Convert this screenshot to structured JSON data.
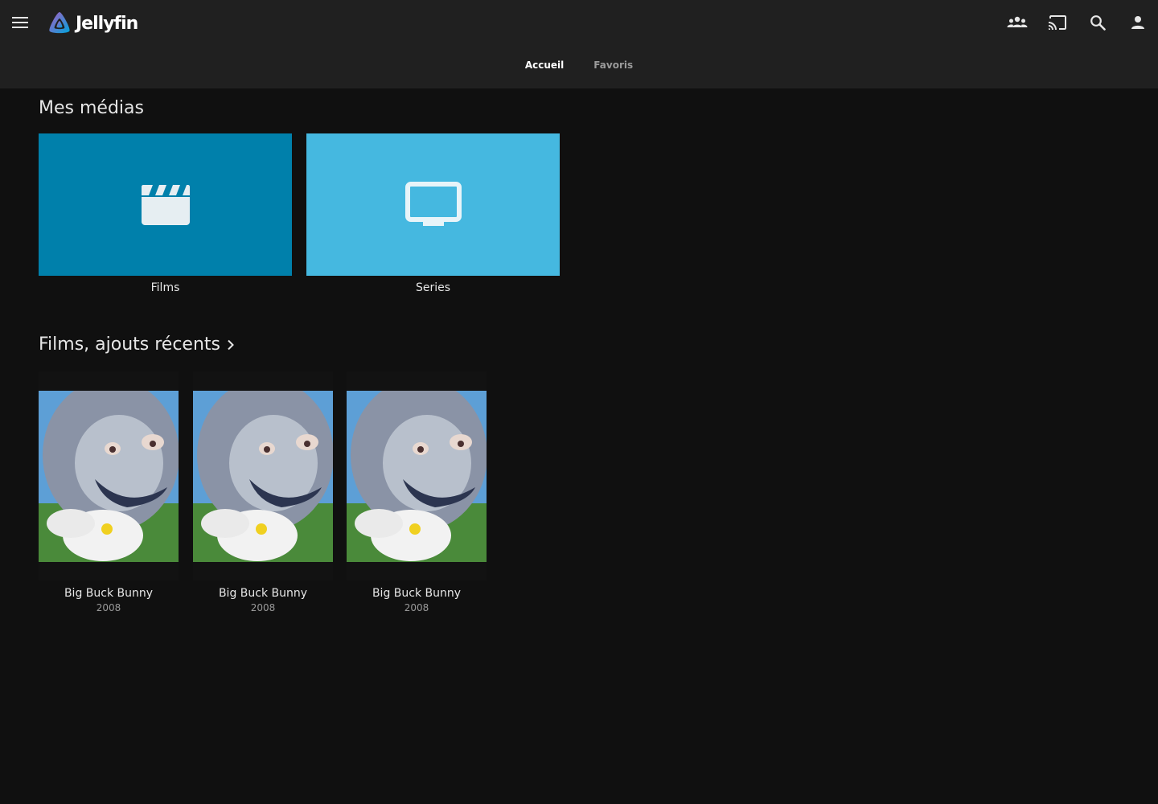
{
  "app": {
    "name": "Jellyfin"
  },
  "header": {
    "icons": [
      "menu-icon",
      "syncplay-icon",
      "cast-icon",
      "search-icon",
      "user-icon"
    ]
  },
  "tabs": [
    {
      "label": "Accueil",
      "active": true
    },
    {
      "label": "Favoris",
      "active": false
    }
  ],
  "libraries": {
    "title": "Mes médias",
    "items": [
      {
        "label": "Films",
        "icon": "clapperboard-icon",
        "color": "#0080ab"
      },
      {
        "label": "Series",
        "icon": "tv-icon",
        "color": "#45b8e0"
      }
    ]
  },
  "recent": {
    "title": "Films, ajouts récents",
    "items": [
      {
        "title": "Big Buck Bunny",
        "year": "2008"
      },
      {
        "title": "Big Buck Bunny",
        "year": "2008"
      },
      {
        "title": "Big Buck Bunny",
        "year": "2008"
      }
    ]
  },
  "colors": {
    "header_bg": "#202020",
    "page_bg": "#101010",
    "films_tile": "#0080ab",
    "series_tile": "#45b8e0"
  }
}
